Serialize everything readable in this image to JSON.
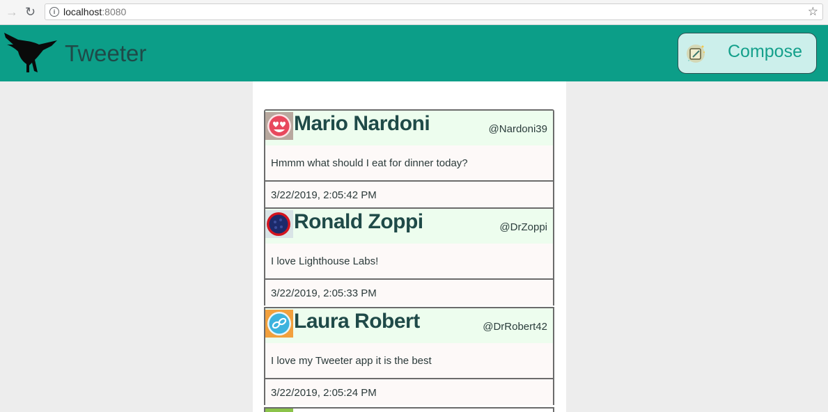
{
  "browser": {
    "url_host": "localhost",
    "url_port": ":8080"
  },
  "header": {
    "brand": "Tweeter",
    "compose_label": "Compose",
    "colors": {
      "nav_bg": "#0c9e88",
      "compose_bg": "#ccefeb",
      "compose_text": "#14a08b"
    }
  },
  "tweets": [
    {
      "name": "Mario Nardoni",
      "handle": "@Nardoni39",
      "content": "Hmmm what should I eat for dinner today?",
      "timestamp": "3/22/2019, 2:05:42 PM",
      "avatar_icon": "heart-eyes-face-icon"
    },
    {
      "name": "Ronald Zoppi",
      "handle": "@DrZoppi",
      "content": "I love Lighthouse Labs!",
      "timestamp": "3/22/2019, 2:05:33 PM",
      "avatar_icon": "dark-ball-icon"
    },
    {
      "name": "Laura Robert",
      "handle": "@DrRobert42",
      "content": "I love my Tweeter app it is the best",
      "timestamp": "3/22/2019, 2:05:24 PM",
      "avatar_icon": "chain-link-icon"
    }
  ]
}
